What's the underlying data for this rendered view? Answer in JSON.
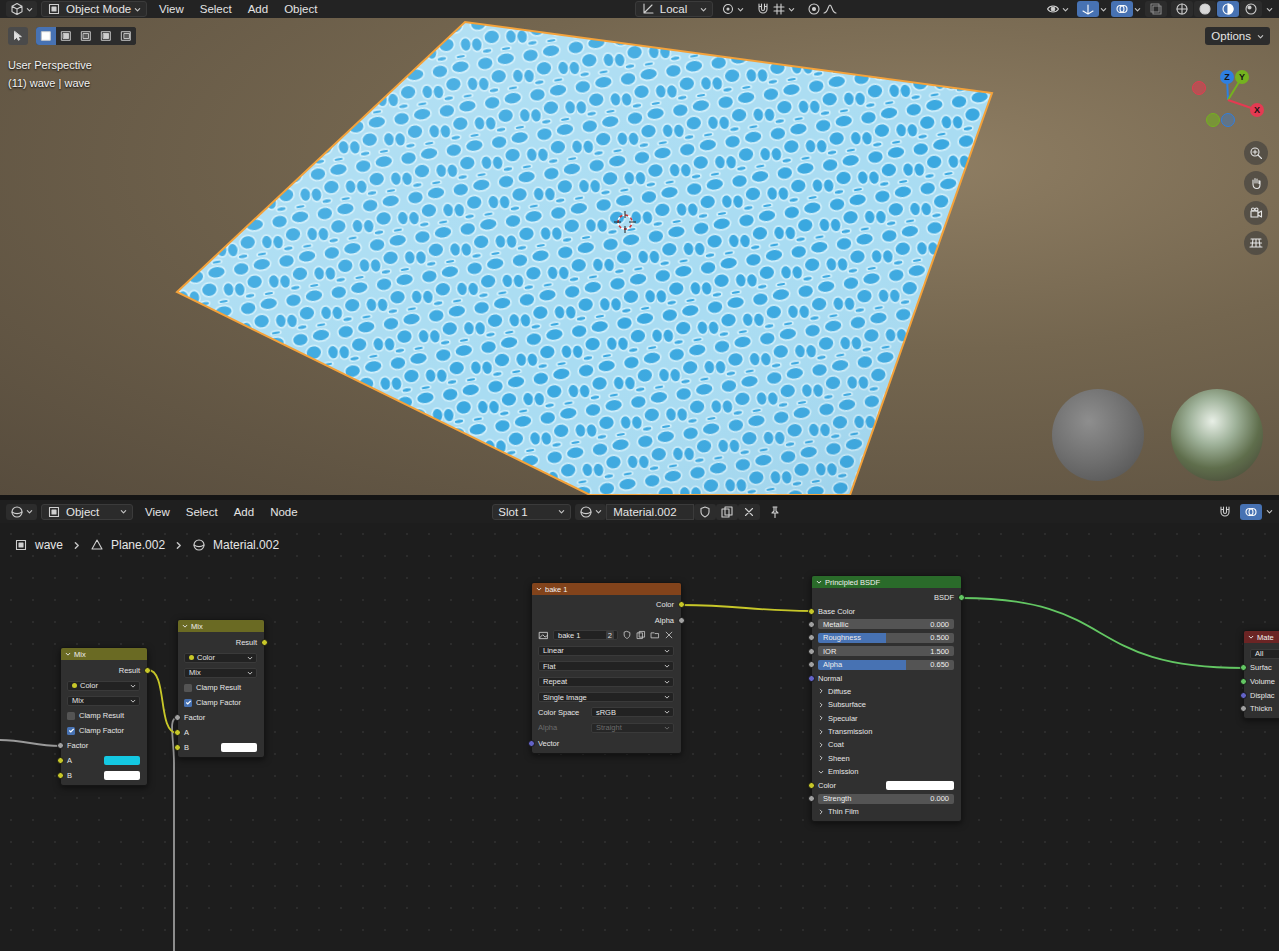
{
  "viewport": {
    "header": {
      "mode": "Object Mode",
      "menus": [
        "View",
        "Select",
        "Add",
        "Object"
      ],
      "orientation": "Local",
      "toggles": [
        {
          "selected": true
        },
        {
          "selected": true
        },
        {
          "selected": false
        }
      ],
      "shading": [
        {
          "selected": false
        },
        {
          "selected": false
        },
        {
          "selected": true
        },
        {
          "selected": false
        }
      ]
    },
    "tools": {
      "select_tool": {
        "selected": true
      },
      "select_modes": [
        {
          "selected": true
        },
        {
          "selected": false
        },
        {
          "selected": false
        },
        {
          "selected": false
        },
        {
          "selected": false
        }
      ]
    },
    "options": "Options",
    "overlay_text": {
      "view": "User Perspective",
      "object": "(11) wave | wave"
    },
    "gizmo": [
      {
        "label": "Z",
        "color": "#2f7fe0"
      },
      {
        "label": "Y",
        "color": "#74b21f"
      },
      {
        "label": "X",
        "color": "#e43a52"
      }
    ]
  },
  "node_editor": {
    "header": {
      "object_mode": "Object",
      "menus": [
        "View",
        "Select",
        "Add",
        "Node"
      ],
      "slot": "Slot 1",
      "material": "Material.002",
      "overlay": {
        "selected": true
      }
    },
    "breadcrumb": [
      "wave",
      "Plane.002",
      "Material.002"
    ],
    "nodes": [
      {
        "title": "Mix",
        "color": "#6a6a23",
        "rows": [
          {
            "kind": "output",
            "label": "Result",
            "color": "#c7c729"
          },
          {
            "kind": "dropdown",
            "label": "Color",
            "dot": "#c7c729"
          },
          {
            "kind": "dropdown",
            "label": "Mix"
          },
          {
            "kind": "checkbox",
            "label": "Clamp Result",
            "checked": false
          },
          {
            "kind": "checkbox",
            "label": "Clamp Factor",
            "checked": true
          },
          {
            "kind": "input",
            "label": "Factor",
            "color": "#a1a1a1"
          },
          {
            "kind": "swatch",
            "label": "A",
            "color": "#c7c729",
            "swatch": "#14c8e2"
          },
          {
            "kind": "swatch",
            "label": "B",
            "color": "#c7c729",
            "swatch": "#ffffff"
          }
        ]
      },
      {
        "title": "Mix",
        "color": "#6a6a23",
        "rows": [
          {
            "kind": "output",
            "label": "Result",
            "color": "#c7c729"
          },
          {
            "kind": "dropdown",
            "label": "Color",
            "dot": "#c7c729"
          },
          {
            "kind": "dropdown",
            "label": "Mix"
          },
          {
            "kind": "checkbox",
            "label": "Clamp Result",
            "checked": false
          },
          {
            "kind": "checkbox",
            "label": "Clamp Factor",
            "checked": true
          },
          {
            "kind": "input",
            "label": "Factor",
            "color": "#a1a1a1"
          },
          {
            "kind": "input",
            "label": "A",
            "color": "#c7c729"
          },
          {
            "kind": "swatch",
            "label": "B",
            "color": "#c7c729",
            "swatch": "#ffffff"
          }
        ]
      },
      {
        "title": "bake 1",
        "color": "#82431b",
        "rows": [
          {
            "kind": "output",
            "label": "Color",
            "color": "#c7c729"
          },
          {
            "kind": "output",
            "label": "Alpha",
            "color": "#a1a1a1"
          },
          {
            "kind": "image",
            "label": "bake 1",
            "users": "2"
          },
          {
            "kind": "dropdown",
            "label": "Linear"
          },
          {
            "kind": "dropdown",
            "label": "Flat"
          },
          {
            "kind": "dropdown",
            "label": "Repeat"
          },
          {
            "kind": "dropdown",
            "label": "Single Image"
          },
          {
            "kind": "labeled",
            "label": "Color Space",
            "value": "sRGB",
            "disabled": false
          },
          {
            "kind": "labeled",
            "label": "Alpha",
            "value": "Straight",
            "disabled": true
          },
          {
            "kind": "input",
            "label": "Vector",
            "color": "#6363c7"
          }
        ]
      },
      {
        "title": "Principled BSDF",
        "color": "#2a6b2a",
        "rows": [
          {
            "kind": "output",
            "label": "BSDF",
            "color": "#63c763"
          },
          {
            "kind": "input",
            "label": "Base Color",
            "color": "#c7c729"
          },
          {
            "kind": "slider",
            "label": "Metallic",
            "value": "0.000",
            "level": 0,
            "color": "#a1a1a1"
          },
          {
            "kind": "slider",
            "label": "Roughness",
            "value": "0.500",
            "level": 0.5,
            "color": "#a1a1a1"
          },
          {
            "kind": "slider",
            "label": "IOR",
            "value": "1.500",
            "level": 0,
            "color": "#a1a1a1"
          },
          {
            "kind": "slider",
            "label": "Alpha",
            "value": "0.650",
            "level": 0.65,
            "color": "#a1a1a1"
          },
          {
            "kind": "input",
            "label": "Normal",
            "color": "#6363c7"
          },
          {
            "kind": "panel",
            "label": "Diffuse",
            "expanded": false
          },
          {
            "kind": "panel",
            "label": "Subsurface",
            "expanded": false
          },
          {
            "kind": "panel",
            "label": "Specular",
            "expanded": false
          },
          {
            "kind": "panel",
            "label": "Transmission",
            "expanded": false
          },
          {
            "kind": "panel",
            "label": "Coat",
            "expanded": false
          },
          {
            "kind": "panel",
            "label": "Sheen",
            "expanded": false
          },
          {
            "kind": "panel",
            "label": "Emission",
            "expanded": true
          },
          {
            "kind": "swatch",
            "label": "Color",
            "color": "#c7c729",
            "swatch": "#ffffff"
          },
          {
            "kind": "slider",
            "label": "Strength",
            "value": "0.000",
            "level": 0,
            "color": "#a1a1a1"
          },
          {
            "kind": "panel",
            "label": "Thin Film",
            "expanded": false
          }
        ]
      },
      {
        "title": "Mate",
        "color": "#6b2424",
        "rows": [
          {
            "kind": "dropdown",
            "label": "All"
          },
          {
            "kind": "input",
            "label": "Surfac",
            "color": "#63c763"
          },
          {
            "kind": "input",
            "label": "Volume",
            "color": "#63c763"
          },
          {
            "kind": "input",
            "label": "Displac",
            "color": "#6363c7"
          },
          {
            "kind": "input",
            "label": "Thickn",
            "color": "#a1a1a1"
          }
        ]
      }
    ]
  }
}
